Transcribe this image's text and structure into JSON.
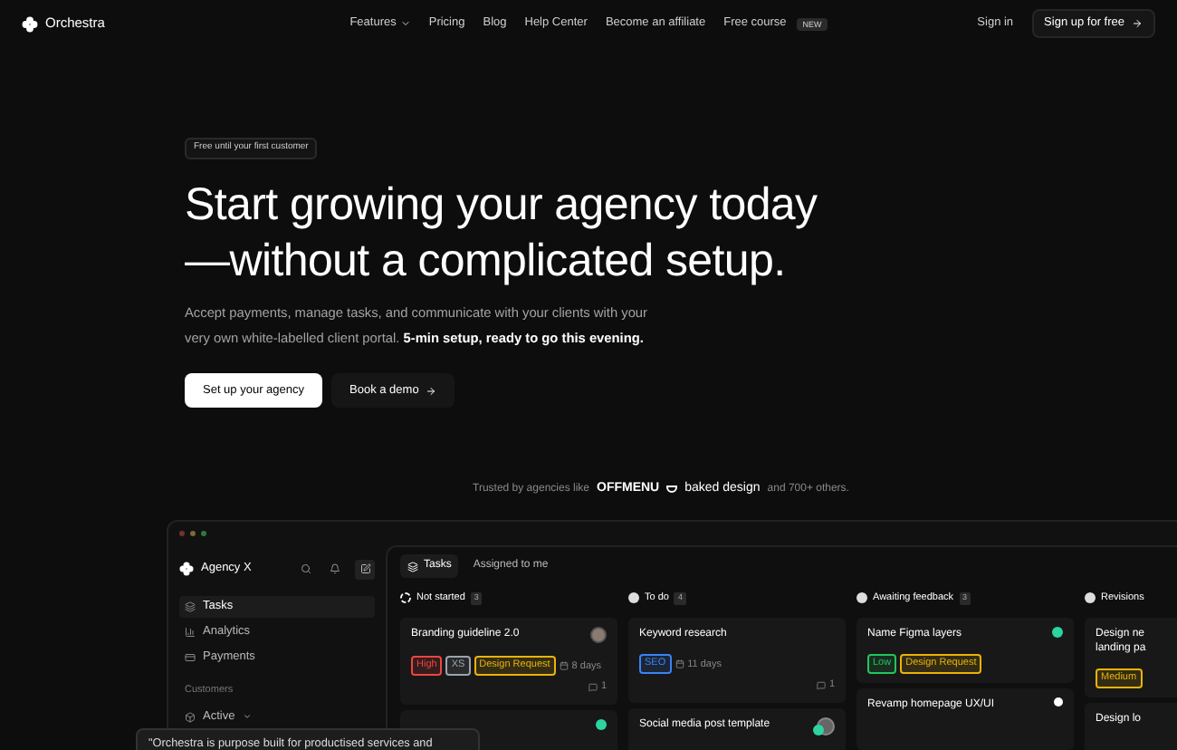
{
  "nav": {
    "brand": "Orchestra",
    "links": [
      {
        "label": "Features",
        "dropdown": true
      },
      {
        "label": "Pricing",
        "dropdown": false
      },
      {
        "label": "Blog",
        "dropdown": false
      },
      {
        "label": "Help Center",
        "dropdown": false
      },
      {
        "label": "Become an affiliate",
        "dropdown": false
      },
      {
        "label": "Free course",
        "dropdown": false,
        "badge": "NEW"
      }
    ],
    "sign_in": "Sign in",
    "signup": "Sign up for free"
  },
  "hero": {
    "badge": "Free until your first customer",
    "headline_lines": [
      "Start growing your agency today",
      "—without a complicated setup."
    ],
    "paragraph": "Accept payments, manage tasks, and communicate with your clients with your very own white-labelled client portal.  **5-min setup, ready to go this evening.**",
    "primary": "Set up your agency",
    "secondary": "Book a demo"
  },
  "trusted": {
    "prefix": "Trusted by agencies like",
    "logos": [
      "OFFMENU",
      "baked design"
    ],
    "suffix": "and 700+ others."
  },
  "app": {
    "workspace": "Agency X",
    "sidebar": [
      {
        "label": "Tasks",
        "selected": true
      },
      {
        "label": "Analytics",
        "selected": false
      },
      {
        "label": "Payments",
        "selected": false
      }
    ],
    "section": "Customers",
    "customers_item": "Active",
    "tabs": [
      {
        "label": "Tasks",
        "selected": true
      },
      {
        "label": "Assigned to me",
        "selected": false
      }
    ],
    "columns": [
      {
        "title": "Not started",
        "count": "3",
        "cards": [
          {
            "title_lines": [
              "Branding guideline 2.0"
            ],
            "kind": "avatar",
            "tags": [
              {
                "text": "High",
                "color": "#ef4444"
              },
              {
                "text": "XS",
                "color": "#9ca3af"
              },
              {
                "text": "Design Request",
                "color": "#eab308"
              }
            ],
            "due": "8 days",
            "comments": "1"
          },
          {
            "kind": "green-dot"
          }
        ]
      },
      {
        "title": "To do",
        "count": "4",
        "cards": [
          {
            "title_lines": [
              "Keyword research"
            ],
            "tags": [
              {
                "text": "SEO",
                "color": "#3b82f6"
              }
            ],
            "due": "11 days",
            "comments": "1"
          },
          {
            "title_lines": [
              "Social media post template"
            ],
            "kind": "avatar-dot"
          }
        ]
      },
      {
        "title": "Awaiting feedback",
        "count": "3",
        "cards": [
          {
            "title_lines": [
              "Name Figma layers"
            ],
            "kind": "green-dot",
            "tags": [
              {
                "text": "Low",
                "color": "#22c55e"
              },
              {
                "text": "Design Request",
                "color": "#eab308"
              }
            ]
          },
          {
            "title_lines": [
              "Revamp homepage UX/UI"
            ],
            "kind": "white-icon"
          }
        ]
      },
      {
        "title": "Revisions",
        "cards": [
          {
            "title_lines": [
              "Design ne",
              "landing pa"
            ],
            "tags": [
              {
                "text": "Medium",
                "color": "#eab308"
              }
            ]
          },
          {
            "title_lines": [
              "Design lo"
            ]
          }
        ]
      }
    ]
  },
  "quote": "\"Orchestra is purpose built for productised services and"
}
